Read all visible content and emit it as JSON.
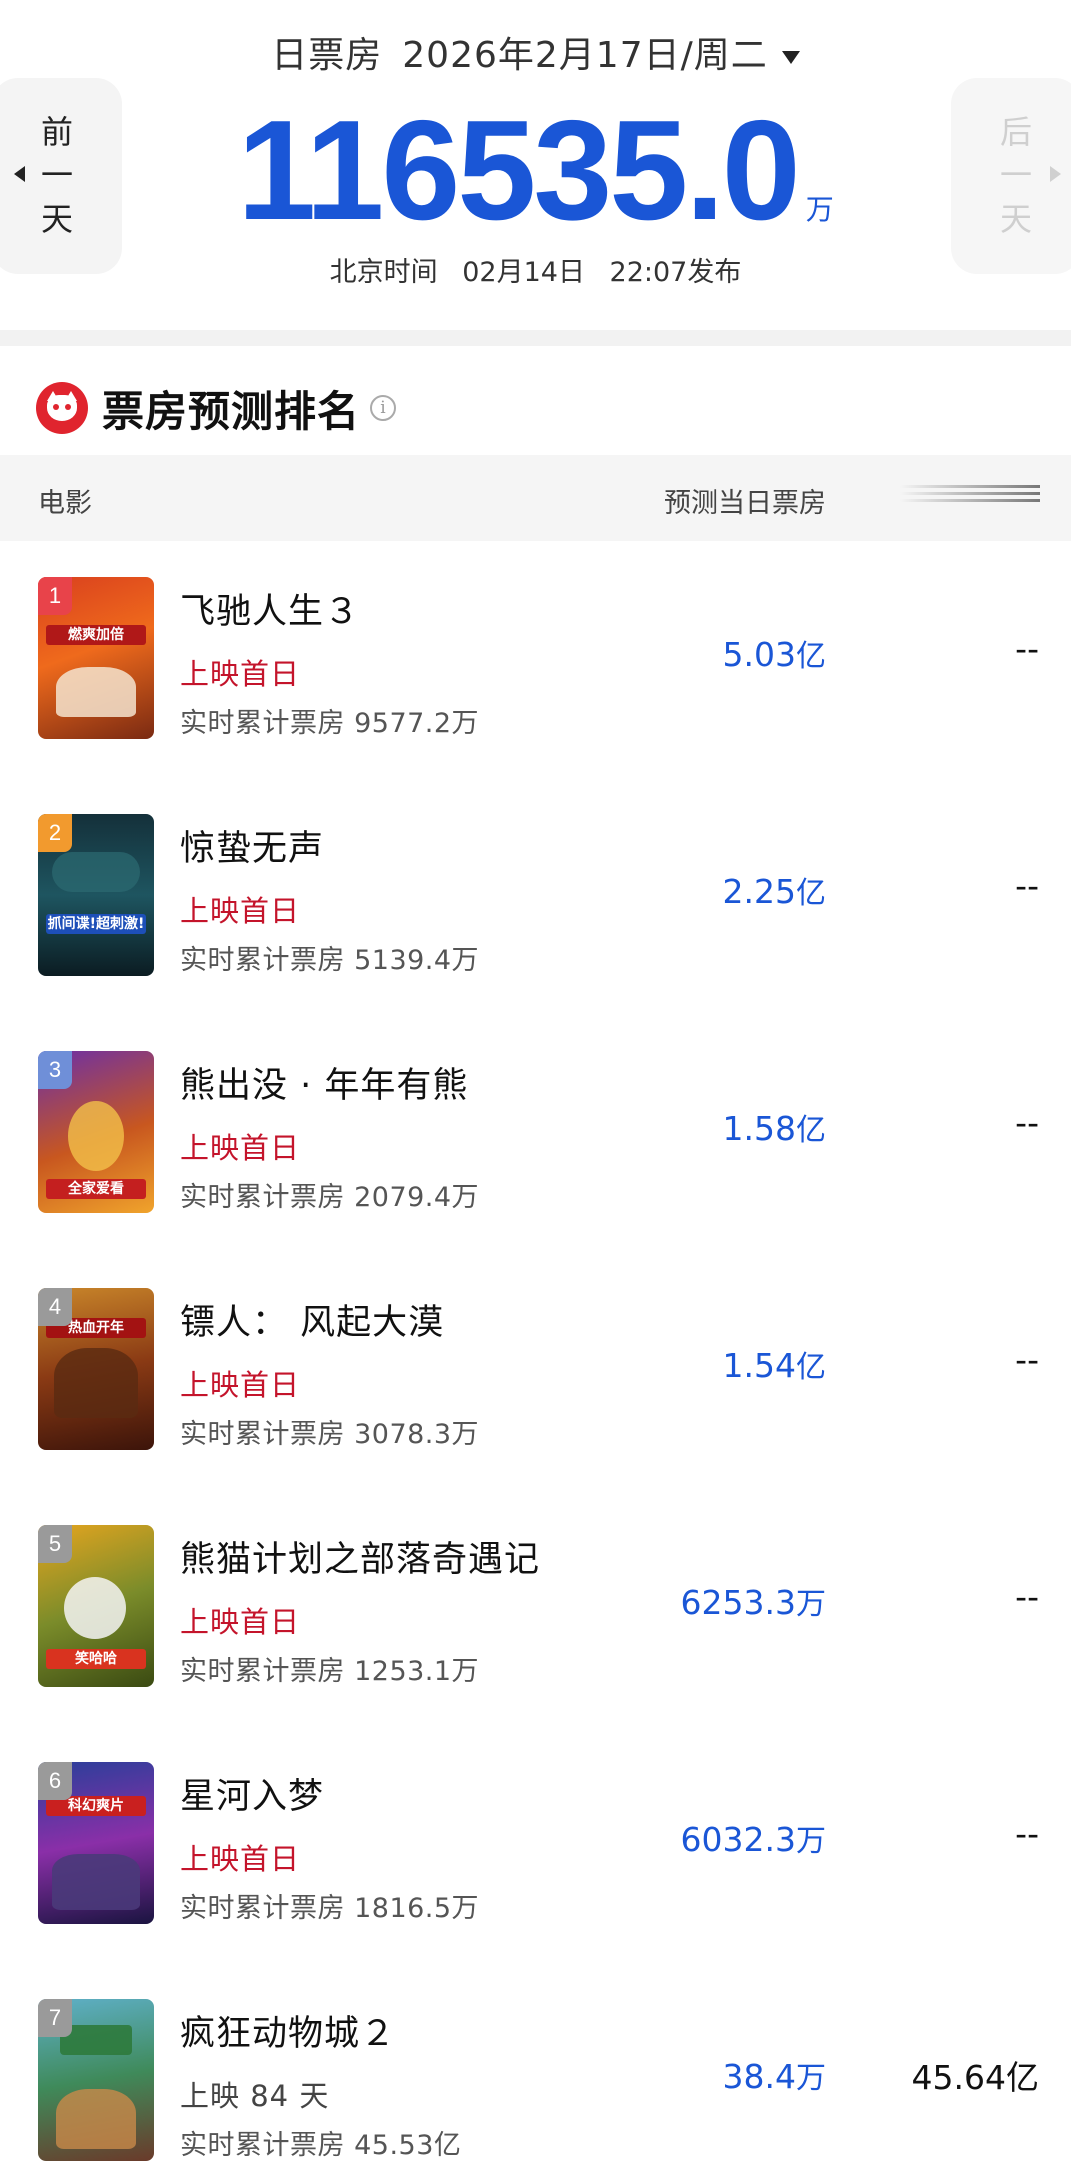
{
  "header": {
    "label": "日票房",
    "date": "2026年2月17日/周二",
    "total_box_office": "116535.0",
    "total_unit": "万",
    "publish_prefix": "北京时间",
    "publish_date": "02月14日",
    "publish_time": "22:07发布",
    "prev_day": [
      "前",
      "一",
      "天"
    ],
    "next_day": [
      "后",
      "一",
      "天"
    ]
  },
  "section": {
    "title": "票房预测排名",
    "info_icon": "i"
  },
  "columns": {
    "movie": "电影",
    "forecast": "预测当日票房"
  },
  "movies": [
    {
      "rank": "1",
      "title": "飞驰人生３",
      "status": "上映首日",
      "cumulative": "实时累计票房 9577.2万",
      "forecast": "5.03",
      "forecast_unit": "亿",
      "extra": "--",
      "poster_text": "燃爽加倍"
    },
    {
      "rank": "2",
      "title": "惊蛰无声",
      "status": "上映首日",
      "cumulative": "实时累计票房 5139.4万",
      "forecast": "2.25",
      "forecast_unit": "亿",
      "extra": "--",
      "poster_text": "抓间谍!超刺激!"
    },
    {
      "rank": "3",
      "title": "熊出没 · 年年有熊",
      "status": "上映首日",
      "cumulative": "实时累计票房 2079.4万",
      "forecast": "1.58",
      "forecast_unit": "亿",
      "extra": "--",
      "poster_text": "全家爱看"
    },
    {
      "rank": "4",
      "title": "镖人： 风起大漠",
      "status": "上映首日",
      "cumulative": "实时累计票房 3078.3万",
      "forecast": "1.54",
      "forecast_unit": "亿",
      "extra": "--",
      "poster_text": "热血开年"
    },
    {
      "rank": "5",
      "title": "熊猫计划之部落奇遇记",
      "status": "上映首日",
      "cumulative": "实时累计票房 1253.1万",
      "forecast": "6253.3",
      "forecast_unit": "万",
      "extra": "--",
      "poster_text": "笑哈哈"
    },
    {
      "rank": "6",
      "title": "星河入梦",
      "status": "上映首日",
      "cumulative": "实时累计票房 1816.5万",
      "forecast": "6032.3",
      "forecast_unit": "万",
      "extra": "--",
      "poster_text": "科幻爽片"
    },
    {
      "rank": "7",
      "title": "疯狂动物城２",
      "status": "上映 84 天",
      "cumulative": "实时累计票房 45.53亿",
      "forecast": "38.4",
      "forecast_unit": "万",
      "extra": "45.64亿",
      "poster_text": ""
    }
  ],
  "colors": {
    "accent_blue": "#1a56d6",
    "status_red": "#c4142b",
    "rank_1": "#e8434a",
    "rank_2": "#f29a2e",
    "rank_3": "#6f8fd8",
    "rank_other": "#9a9a9a"
  }
}
